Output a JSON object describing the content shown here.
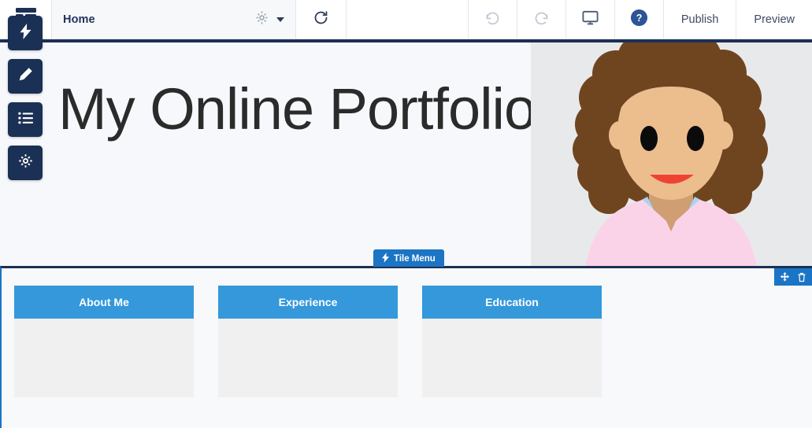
{
  "toolbar": {
    "logo_icon": "layout-grid-icon",
    "page_name": "Home",
    "page_settings_icon": "gear-icon",
    "page_dropdown_icon": "chevron-down-icon",
    "refresh_icon": "refresh-icon",
    "undo_icon": "undo-icon",
    "redo_icon": "redo-icon",
    "device_icon": "desktop-monitor-icon",
    "help_icon": "help-circle-icon",
    "publish_label": "Publish",
    "preview_label": "Preview"
  },
  "sidebar": {
    "items": [
      {
        "name": "quick-add",
        "icon": "lightning-bolt-icon"
      },
      {
        "name": "design",
        "icon": "pencil-icon"
      },
      {
        "name": "pages",
        "icon": "list-icon"
      },
      {
        "name": "settings",
        "icon": "gear-icon"
      }
    ]
  },
  "hero": {
    "title": "My Online Portfolio",
    "image_alt": "woman-avatar-illustration"
  },
  "tile_menu_badge": {
    "label": "Tile Menu",
    "icon": "lightning-bolt-icon"
  },
  "region_tools": {
    "move_icon": "move-arrows-icon",
    "delete_icon": "trash-icon"
  },
  "tiles": [
    {
      "label": "About Me"
    },
    {
      "label": "Experience"
    },
    {
      "label": "Education"
    }
  ],
  "colors": {
    "brand_navy": "#1b3055",
    "accent_blue": "#1b74c4",
    "tile_blue": "#3498db",
    "canvas_bg": "#f6f8fb",
    "hair": "#6f4520",
    "skin": "#ecbe8e",
    "lips": "#ef4331",
    "collar": "#a8d4f0",
    "shirt": "#fbd3e9"
  }
}
